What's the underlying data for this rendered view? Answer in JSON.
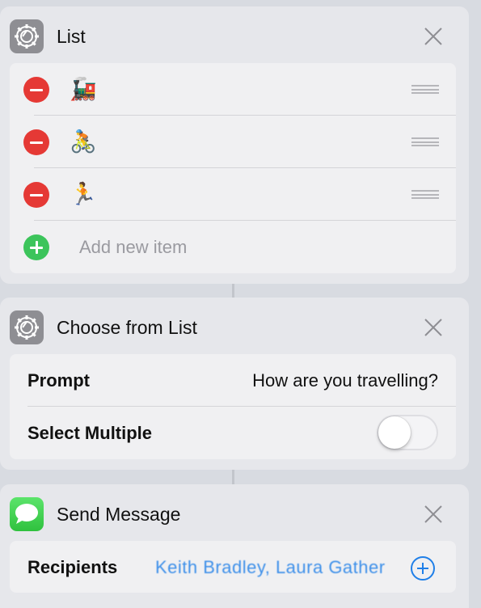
{
  "list_card": {
    "title": "List",
    "icon": "gear-icon",
    "items": [
      {
        "emoji": "🚂",
        "name": "train"
      },
      {
        "emoji": "🚴",
        "name": "bicycle"
      },
      {
        "emoji": "🏃",
        "name": "running"
      }
    ],
    "add_placeholder": "Add new item"
  },
  "choose_card": {
    "title": "Choose from List",
    "icon": "gear-icon",
    "prompt_label": "Prompt",
    "prompt_value": "How are you travelling?",
    "multiple_label": "Select Multiple",
    "multiple_enabled": false
  },
  "send_card": {
    "title": "Send Message",
    "icon": "messages-icon",
    "recipients_label": "Recipients",
    "recipients_value": "Keith Bradley, Laura Gather"
  },
  "colors": {
    "background": "#d8dbe1",
    "card": "#e6e7eb",
    "inner": "#f0f0f2",
    "delete_red": "#e53935",
    "add_green": "#3cc45b",
    "link_blue": "#1f7fe8"
  }
}
